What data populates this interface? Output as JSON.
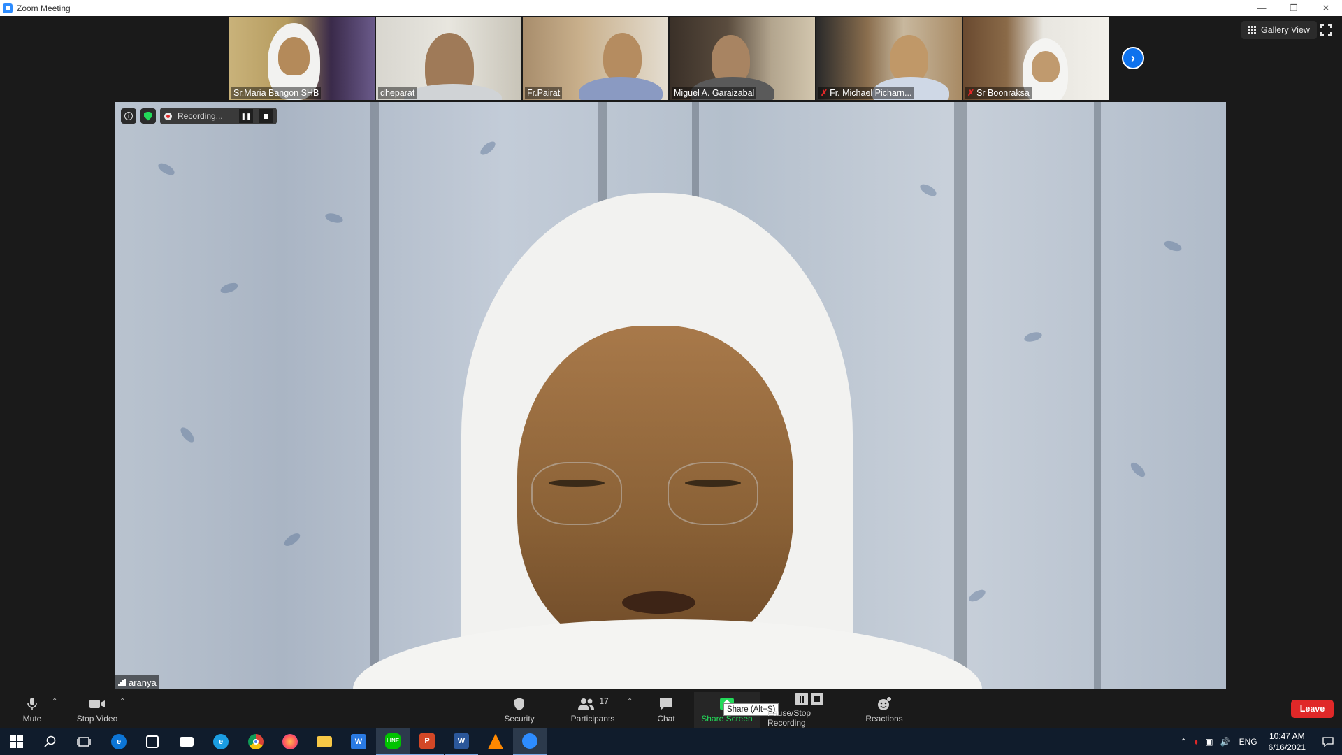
{
  "window": {
    "title": "Zoom Meeting"
  },
  "gallery": {
    "participants": [
      {
        "name": "Sr.Maria Bangon SHB",
        "muted": false
      },
      {
        "name": "dheparat",
        "muted": false
      },
      {
        "name": "Fr.Pairat",
        "muted": false
      },
      {
        "name": "Miguel A. Garaizabal",
        "muted": false
      },
      {
        "name": "Fr. Michael Picharn...",
        "muted": true
      },
      {
        "name": "Sr Boonraksa",
        "muted": true
      }
    ],
    "view_button_label": "Gallery View"
  },
  "recording": {
    "status_text": "Recording..."
  },
  "active_speaker": {
    "name": "aranya"
  },
  "toolbar": {
    "mute_label": "Mute",
    "video_label": "Stop Video",
    "security_label": "Security",
    "participants_label": "Participants",
    "participants_count": "17",
    "chat_label": "Chat",
    "share_label": "Share Screen",
    "share_tooltip": "Share (Alt+S)",
    "recording_label": "Pause/Stop Recording",
    "reactions_label": "Reactions",
    "leave_label": "Leave"
  },
  "taskbar": {
    "language": "ENG",
    "time": "10:47 AM",
    "date": "6/16/2021"
  },
  "colors": {
    "accent_blue": "#0e72ed",
    "leave_red": "#e02828",
    "share_green": "#23d959",
    "taskbar": "#101c2c"
  }
}
